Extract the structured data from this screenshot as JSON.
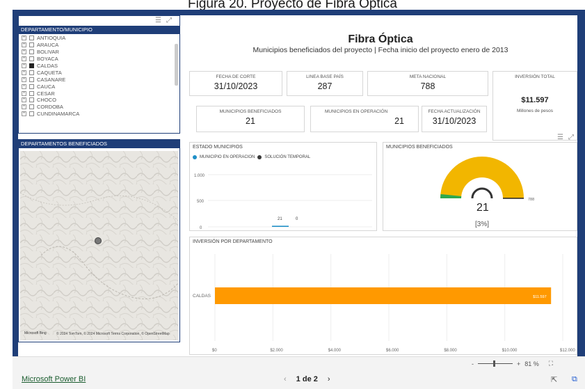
{
  "doc_title": "Figura 20. Proyecto de Fibra Óptica",
  "slicer": {
    "header": "DEPARTAMENTO/MUNICIPIO",
    "items": [
      {
        "label": "ANTIOQUIA",
        "checked": false
      },
      {
        "label": "ARAUCA",
        "checked": false
      },
      {
        "label": "BOLIVAR",
        "checked": false
      },
      {
        "label": "BOYACA",
        "checked": false
      },
      {
        "label": "CALDAS",
        "checked": true
      },
      {
        "label": "CAQUETA",
        "checked": false
      },
      {
        "label": "CASANARE",
        "checked": false
      },
      {
        "label": "CAUCA",
        "checked": false
      },
      {
        "label": "CESAR",
        "checked": false
      },
      {
        "label": "CHOCO",
        "checked": false
      },
      {
        "label": "CORDOBA",
        "checked": false
      },
      {
        "label": "CUNDINAMARCA",
        "checked": false
      }
    ]
  },
  "map": {
    "header": "DEPARTAMENTOS BENEFICIADOS",
    "logo": "Microsoft Bing",
    "credit": "© 2024 TomTom, © 2024 Microsoft Terms Corporation, © OpenStreetMap"
  },
  "report": {
    "title": "Fibra Óptica",
    "subtitle": "Municipios beneficiados del proyecto | Fecha inicio del proyecto enero de 2013"
  },
  "kpis": {
    "fecha_corte": {
      "label": "FECHA DE CORTE",
      "value": "31/10/2023"
    },
    "linea_base": {
      "label": "LINEA BASE PAÍS",
      "value": "287"
    },
    "meta_nacional": {
      "label": "META NACIONAL",
      "value": "788"
    },
    "inversion_total": {
      "label": "INVERSIÓN TOTAL",
      "value": "$11.597",
      "sub": "Millones de pesos"
    },
    "municipios_beneficiados": {
      "label": "MUNICIPIOS BENEFICIADOS",
      "value": "21"
    },
    "municipios_operacion": {
      "label": "MUNICIPIOS EN OPERACIÓN",
      "value": "21"
    },
    "fecha_actualizacion": {
      "label": "FECHA ACTUALIZACIÓN",
      "value": "31/10/2023"
    }
  },
  "estado_chart": {
    "title": "ESTADO MUNICIPIOS",
    "legend": [
      {
        "name": "MUNICIPIO EN OPERACION",
        "color": "#1f8fc7"
      },
      {
        "name": "SOLUCIÓN TEMPORAL",
        "color": "#3a3a3a"
      }
    ],
    "ticks": [
      "1.000",
      "500",
      "0"
    ],
    "labels": [
      "21",
      "0"
    ]
  },
  "gauge": {
    "title": "MUNICIPIOS BENEFICIADOS",
    "value_label": "21",
    "max_label": "788",
    "percent_label": "[3%]",
    "color": "#f2b600"
  },
  "inversion_chart": {
    "title": "INVERSIÓN POR DEPARTAMENTO",
    "category": "CALDAS",
    "value_label": "$11.597",
    "x_ticks": [
      "$0",
      "$2.000",
      "$4.000",
      "$6.000",
      "$8.000",
      "$10.000",
      "$12.000"
    ],
    "bar_color": "#ff9900"
  },
  "chart_data": [
    {
      "type": "bar",
      "title": "ESTADO MUNICIPIOS",
      "categories": [
        ""
      ],
      "series": [
        {
          "name": "MUNICIPIO EN OPERACION",
          "values": [
            21
          ]
        },
        {
          "name": "SOLUCIÓN TEMPORAL",
          "values": [
            0
          ]
        }
      ],
      "ylim": [
        0,
        1000
      ]
    },
    {
      "type": "bar",
      "title": "INVERSIÓN POR DEPARTAMENTO",
      "categories": [
        "CALDAS"
      ],
      "values": [
        11597
      ],
      "xlim": [
        0,
        12000
      ]
    }
  ],
  "footer": {
    "zoom": "81 %",
    "page": "1 de 2",
    "brand": "Microsoft Power BI"
  }
}
